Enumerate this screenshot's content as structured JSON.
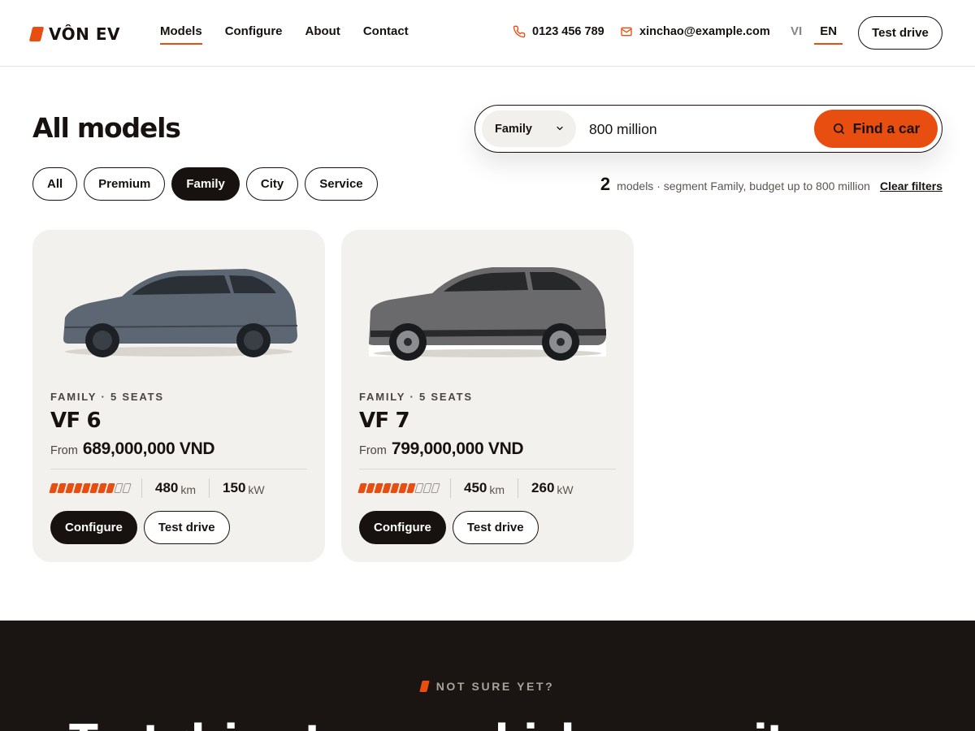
{
  "brand": {
    "name": "VÔN EV",
    "accent": "#e84e0f",
    "dark": "#17120f"
  },
  "nav": {
    "items": [
      {
        "label": "Models",
        "active": true
      },
      {
        "label": "Configure",
        "active": false
      },
      {
        "label": "About",
        "active": false
      },
      {
        "label": "Contact",
        "active": false
      }
    ]
  },
  "contact": {
    "phone": "0123 456 789",
    "email": "xinchao@example.com",
    "phone_icon": "phone-icon",
    "email_icon": "mail-icon"
  },
  "lang": {
    "options": [
      "VI",
      "EN"
    ],
    "selected": "EN"
  },
  "header_cta": "Test drive",
  "page_title": "All models",
  "search": {
    "segment_value": "Family",
    "budget_value": "800 million",
    "button_label": "Find a car",
    "button_icon": "search-icon"
  },
  "filters": {
    "chips": [
      {
        "label": "All",
        "active": false
      },
      {
        "label": "Premium",
        "active": false
      },
      {
        "label": "Family",
        "active": true
      },
      {
        "label": "City",
        "active": false
      },
      {
        "label": "Service",
        "active": false
      }
    ]
  },
  "results": {
    "count": "2",
    "text": "models · segment Family, budget up to 800 million",
    "clear_label": "Clear filters"
  },
  "cards": [
    {
      "meta": "FAMILY · 5 SEATS",
      "name": "VF 6",
      "from_label": "From",
      "price": "689,000,000 VND",
      "rating": 8,
      "rating_max": 10,
      "range_value": "480",
      "range_unit": "km",
      "power_value": "150",
      "power_unit": "kW",
      "configure_label": "Configure",
      "test_drive_label": "Test drive",
      "car_color": "#5d6673"
    },
    {
      "meta": "FAMILY · 5 SEATS",
      "name": "VF 7",
      "from_label": "From",
      "price": "799,000,000 VND",
      "rating": 7,
      "rating_max": 10,
      "range_value": "450",
      "range_unit": "km",
      "power_value": "260",
      "power_unit": "kW",
      "configure_label": "Configure",
      "test_drive_label": "Test drive",
      "car_color": "#6a6a6c"
    }
  ],
  "bottom": {
    "eyebrow": "NOT SURE YET?",
    "headline": "Test drive to see which one suits you"
  }
}
